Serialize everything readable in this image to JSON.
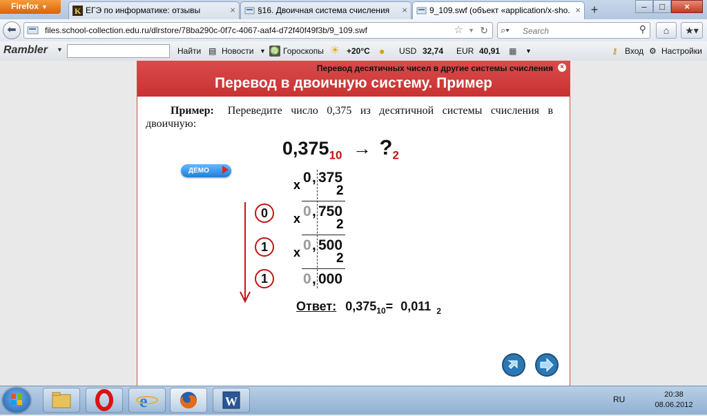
{
  "browser": {
    "menu_button": "Firefox",
    "tabs": [
      {
        "title": "ЕГЭ по информатике: отзывы",
        "active": false
      },
      {
        "title": "§16. Двоичная система счисления",
        "active": false
      },
      {
        "title": "9_109.swf (объект «application/x-sho...",
        "active": true
      }
    ],
    "new_tab": "+",
    "window": {
      "minimize": "–",
      "maximize": "□",
      "close": "×"
    },
    "url": "files.school-collection.edu.ru/dlrstore/78ba290c-0f7c-4067-aaf4-d72f40f49f3b/9_109.swf",
    "search_placeholder": "Search"
  },
  "rambler": {
    "logo": "Rambler",
    "search_button": "Найти",
    "news": "Новости",
    "horoscope": "Гороскопы",
    "temperature": "+20°C",
    "usd_label": "USD",
    "usd_value": "32,74",
    "eur_label": "EUR",
    "eur_value": "40,91",
    "login": "Вход",
    "settings": "Настройки"
  },
  "flash": {
    "subtitle": "Перевод десятичных чисел в другие системы счисления",
    "title": "Перевод в двоичную систему. Пример",
    "example_label": "Пример:",
    "example_text": "Переведите  число  0,375  из десятичной системы счисления в двоичную:",
    "equation": {
      "number": "0,375",
      "base_from": "10",
      "arrow": "→",
      "question": "?",
      "base_to": "2"
    },
    "demo_button": "ДЕМО",
    "steps": [
      {
        "sign": "x",
        "int": "0",
        "frac": "375",
        "multiplier": "2",
        "int_gray": false
      },
      {
        "digit": "0",
        "sign": "x",
        "int": "0",
        "frac": "750",
        "multiplier": "2",
        "int_gray": true
      },
      {
        "digit": "1",
        "sign": "x",
        "int": "0",
        "frac": "500",
        "multiplier": "2",
        "int_gray": true
      },
      {
        "digit": "1",
        "int": "0",
        "frac": "000",
        "int_gray": true
      }
    ],
    "answer": {
      "label": "Ответ:",
      "lhs": "0,375",
      "lhs_base": "10",
      "eq": "=",
      "rhs": "0,011",
      "rhs_base": "2"
    }
  },
  "taskbar": {
    "lang": "RU",
    "time": "20:38",
    "date": "08.06.2012"
  }
}
